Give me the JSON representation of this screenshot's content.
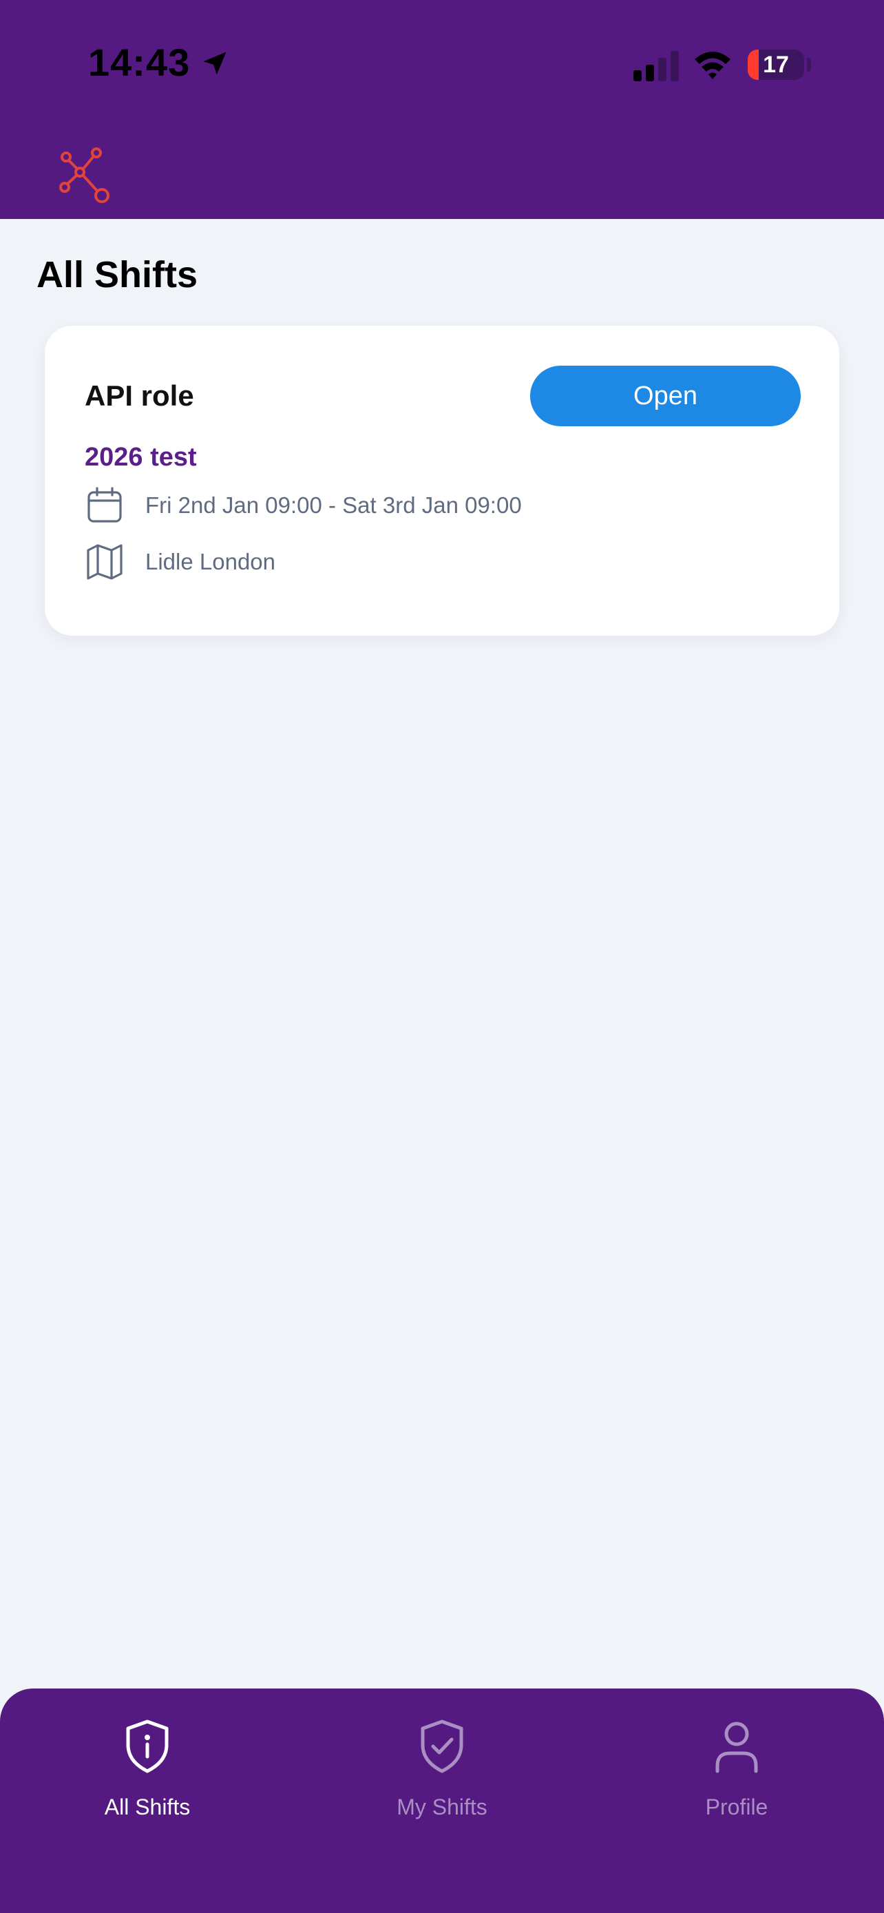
{
  "status_bar": {
    "time": "14:43",
    "battery_level": "17",
    "icons": [
      "location-arrow-icon",
      "cellular-signal-icon",
      "wifi-icon",
      "battery-icon"
    ]
  },
  "header": {
    "logo_icon": "network-nodes-logo-icon",
    "logo_color": "#e0443a",
    "background_color": "#551a82"
  },
  "page": {
    "title": "All Shifts"
  },
  "shifts": [
    {
      "role": "API role",
      "status_button": "Open",
      "name": "2026 test",
      "date_range": "Fri 2nd Jan 09:00 - Sat 3rd Jan 09:00",
      "location": "Lidle London",
      "icons": [
        "calendar-icon",
        "map-icon"
      ]
    }
  ],
  "colors": {
    "accent_blue": "#1e88e5",
    "brand_purple": "#551a82",
    "shift_name_purple": "#5b1f89"
  },
  "tab_bar": {
    "tabs": [
      {
        "label": "All Shifts",
        "icon": "shield-info-icon",
        "active": true
      },
      {
        "label": "My Shifts",
        "icon": "shield-check-icon",
        "active": false
      },
      {
        "label": "Profile",
        "icon": "person-icon",
        "active": false
      }
    ]
  }
}
